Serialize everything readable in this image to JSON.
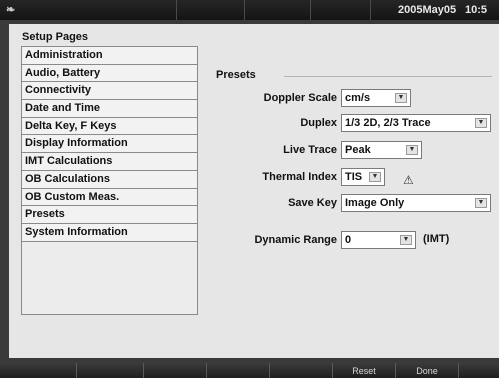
{
  "status_bar": {
    "date": "2005May05",
    "time": "10:5"
  },
  "setup": {
    "title": "Setup Pages",
    "pages": [
      "Administration",
      "Audio, Battery",
      "Connectivity",
      "Date and Time",
      "Delta Key, F Keys",
      "Display Information",
      "IMT Calculations",
      "OB Calculations",
      "OB Custom Meas.",
      "Presets",
      "System Information"
    ],
    "selected": "Presets"
  },
  "presets": {
    "title": "Presets",
    "doppler_scale": {
      "label": "Doppler Scale",
      "value": "cm/s"
    },
    "duplex": {
      "label": "Duplex",
      "value": "1/3 2D, 2/3 Trace"
    },
    "live_trace": {
      "label": "Live Trace",
      "value": "Peak"
    },
    "thermal_index": {
      "label": "Thermal Index",
      "value": "TIS",
      "icon": "warning-icon"
    },
    "save_key": {
      "label": "Save Key",
      "value": "Image Only"
    },
    "dynamic_range": {
      "label": "Dynamic Range",
      "value": "0",
      "suffix": "(IMT)"
    }
  },
  "softkeys": {
    "reset": "Reset",
    "done": "Done"
  }
}
